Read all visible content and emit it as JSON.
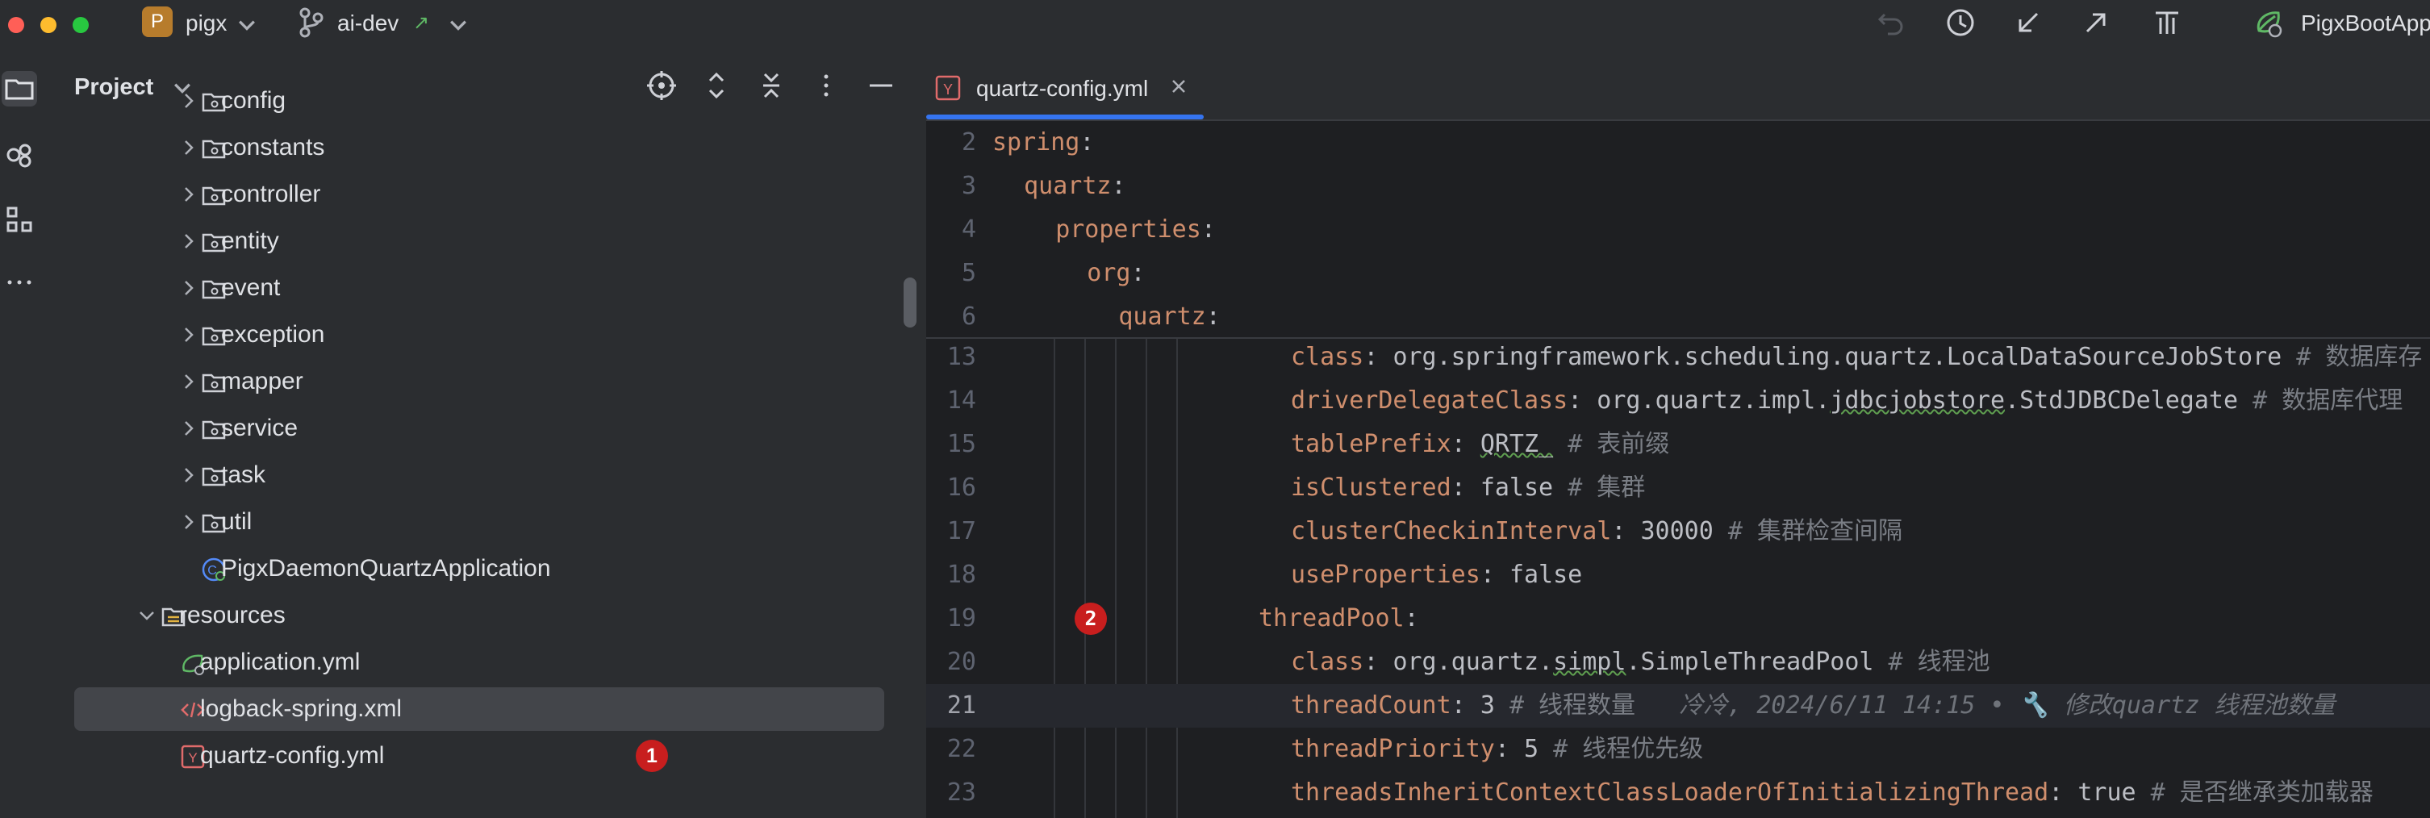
{
  "titlebar": {
    "project_badge": "P",
    "project_name": "pigx",
    "branch_name": "ai-dev",
    "branch_arrow": "↗",
    "run_config": "PigxBootApp",
    "icons": [
      "undo-icon",
      "history-icon",
      "update-icon",
      "push-icon",
      "vcs-icon",
      "run-config-icon"
    ]
  },
  "tool_strip": {
    "icons": [
      "folder-icon",
      "git-commit-icon",
      "structure-icon",
      "more-icon"
    ]
  },
  "project_panel": {
    "title": "Project",
    "header_icons": [
      "locate-icon",
      "expand-all-icon",
      "collapse-all-icon",
      "options-icon",
      "hide-icon"
    ],
    "tree": [
      {
        "label": "config",
        "type": "folder",
        "expanded": false
      },
      {
        "label": "constants",
        "type": "folder",
        "expanded": false
      },
      {
        "label": "controller",
        "type": "folder",
        "expanded": false
      },
      {
        "label": "entity",
        "type": "folder",
        "expanded": false
      },
      {
        "label": "event",
        "type": "folder",
        "expanded": false
      },
      {
        "label": "exception",
        "type": "folder",
        "expanded": false
      },
      {
        "label": "mapper",
        "type": "folder",
        "expanded": false
      },
      {
        "label": "service",
        "type": "folder",
        "expanded": false
      },
      {
        "label": "task",
        "type": "folder",
        "expanded": false
      },
      {
        "label": "util",
        "type": "folder",
        "expanded": false
      },
      {
        "label": "PigxDaemonQuartzApplication",
        "type": "spring-class"
      },
      {
        "label": "resources",
        "type": "resources-folder",
        "expanded": true
      },
      {
        "label": "application.yml",
        "type": "spring-yml"
      },
      {
        "label": "logback-spring.xml",
        "type": "xml",
        "selected": true
      },
      {
        "label": "quartz-config.yml",
        "type": "yml"
      }
    ],
    "badge_1": "1"
  },
  "editor": {
    "tab_label": "quartz-config.yml",
    "badge_2": "2",
    "sticky_lines": [
      {
        "num": "2",
        "key": "spring",
        "rest": ":"
      },
      {
        "num": "3",
        "key": "quartz",
        "rest": ":"
      },
      {
        "num": "4",
        "key": "properties",
        "rest": ":"
      },
      {
        "num": "5",
        "key": "org",
        "rest": ":"
      },
      {
        "num": "6",
        "key": "quartz",
        "rest": ":"
      }
    ],
    "lines": [
      {
        "num": "13",
        "key": "class",
        "value": "org.springframework.scheduling.quartz.LocalDataSourceJobStore",
        "comment": "# 数据库存"
      },
      {
        "num": "14",
        "key": "driverDelegateClass",
        "value_pre": "org.quartz.impl.",
        "value_sq": "jdbcjobstore",
        "value_post": ".StdJDBCDelegate",
        "comment": "# 数据库代理"
      },
      {
        "num": "15",
        "key": "tablePrefix",
        "value_sq": "QRTZ_",
        "comment": "# 表前缀"
      },
      {
        "num": "16",
        "key": "isClustered",
        "value": "false",
        "comment": "# 集群"
      },
      {
        "num": "17",
        "key": "clusterCheckinInterval",
        "value": "30000",
        "comment": "# 集群检查间隔"
      },
      {
        "num": "18",
        "key": "useProperties",
        "value": "false",
        "comment": ""
      },
      {
        "num": "19",
        "key": "threadPool",
        "value": "",
        "comment": ""
      },
      {
        "num": "20",
        "key": "class",
        "value_pre": "org.quartz.",
        "value_sq": "simpl",
        "value_post": ".SimpleThreadPool",
        "comment": "# 线程池"
      },
      {
        "num": "21",
        "key": "threadCount",
        "value": "3",
        "comment": "# 线程数量",
        "hint": "冷冷, 2024/6/11 14:15 • 🔧 修改quartz 线程池数量"
      },
      {
        "num": "22",
        "key": "threadPriority",
        "value": "5",
        "comment": "# 线程优先级"
      },
      {
        "num": "23",
        "key": "threadsInheritContextClassLoaderOfInitializingThread",
        "value": "true",
        "comment": "# 是否继承类加载器"
      }
    ]
  },
  "colors": {
    "accent": "#3574f0",
    "key": "#cf8e6d",
    "comment": "#7a7e85",
    "badge": "#c81e1e"
  }
}
